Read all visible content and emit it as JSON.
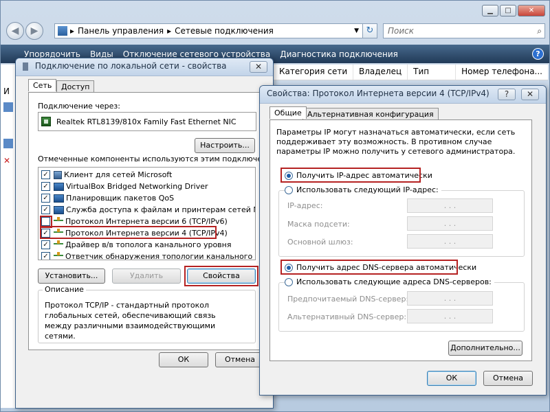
{
  "explorer": {
    "breadcrumb": [
      "Панель управления",
      "Сетевые подключения"
    ],
    "search_placeholder": "Поиск",
    "commands": [
      "Упорядочить",
      "Виды",
      "Отключение сетевого устройства",
      "Диагностика подключения"
    ],
    "help_label": "?",
    "columns": [
      "Категория сети",
      "Владелец",
      "Тип",
      "Номер телефона..."
    ],
    "left_header": "И"
  },
  "dialog1": {
    "title": "Подключение по локальной сети - свойства",
    "close_label": "✕",
    "tabs": [
      "Сеть",
      "Доступ"
    ],
    "connect_via_label": "Подключение через:",
    "adapter_name": "Realtek RTL8139/810x Family Fast Ethernet NIC",
    "configure_button": "Настроить...",
    "components_label": "Отмеченные компоненты используются этим подключением:",
    "components": [
      {
        "label": "Клиент для сетей Microsoft",
        "checked": true
      },
      {
        "label": "VirtualBox Bridged Networking Driver",
        "checked": true
      },
      {
        "label": "Планировщик пакетов QoS",
        "checked": true
      },
      {
        "label": "Служба доступа к файлам и принтерам сетей Micro...",
        "checked": true
      },
      {
        "label": "Протокол Интернета версии 6 (TCP/IPv6)",
        "checked": false
      },
      {
        "label": "Протокол Интернета версии 4 (TCP/IPv4)",
        "checked": true
      },
      {
        "label": "Драйвер в/в тополога канального уровня",
        "checked": true
      },
      {
        "label": "Ответчик обнаружения топологии канального уровня",
        "checked": true
      }
    ],
    "install_button": "Установить...",
    "remove_button": "Удалить",
    "properties_button": "Свойства",
    "description_legend": "Описание",
    "description_text": "Протокол TCP/IP - стандартный протокол глобальных сетей, обеспечивающий связь между различными взаимодействующими сетями.",
    "ok_button": "ОК",
    "cancel_button": "Отмена"
  },
  "dialog2": {
    "title": "Свойства: Протокол Интернета версии 4 (TCP/IPv4)",
    "help_label": "?",
    "close_label": "✕",
    "tabs": [
      "Общие",
      "Альтернативная конфигурация"
    ],
    "info_text": "Параметры IP могут назначаться автоматически, если сеть поддерживает эту возможность. В противном случае параметры IP можно получить у сетевого администратора.",
    "ip_auto": "Получить IP-адрес автоматически",
    "ip_manual": "Использовать следующий IP-адрес:",
    "ip_address_label": "IP-адрес:",
    "subnet_label": "Маска подсети:",
    "gateway_label": "Основной шлюз:",
    "dns_auto": "Получить адрес DNS-сервера автоматически",
    "dns_manual": "Использовать следующие адреса DNS-серверов:",
    "dns_preferred_label": "Предпочитаемый DNS-сервер:",
    "dns_alternate_label": "Альтернативный DNS-сервер:",
    "ip_placeholder_dots": ".   .   .",
    "advanced_button": "Дополнительно...",
    "ok_button": "ОК",
    "cancel_button": "Отмена"
  },
  "colors": {
    "highlight": "#b52121",
    "accent": "#1e5ea8"
  }
}
